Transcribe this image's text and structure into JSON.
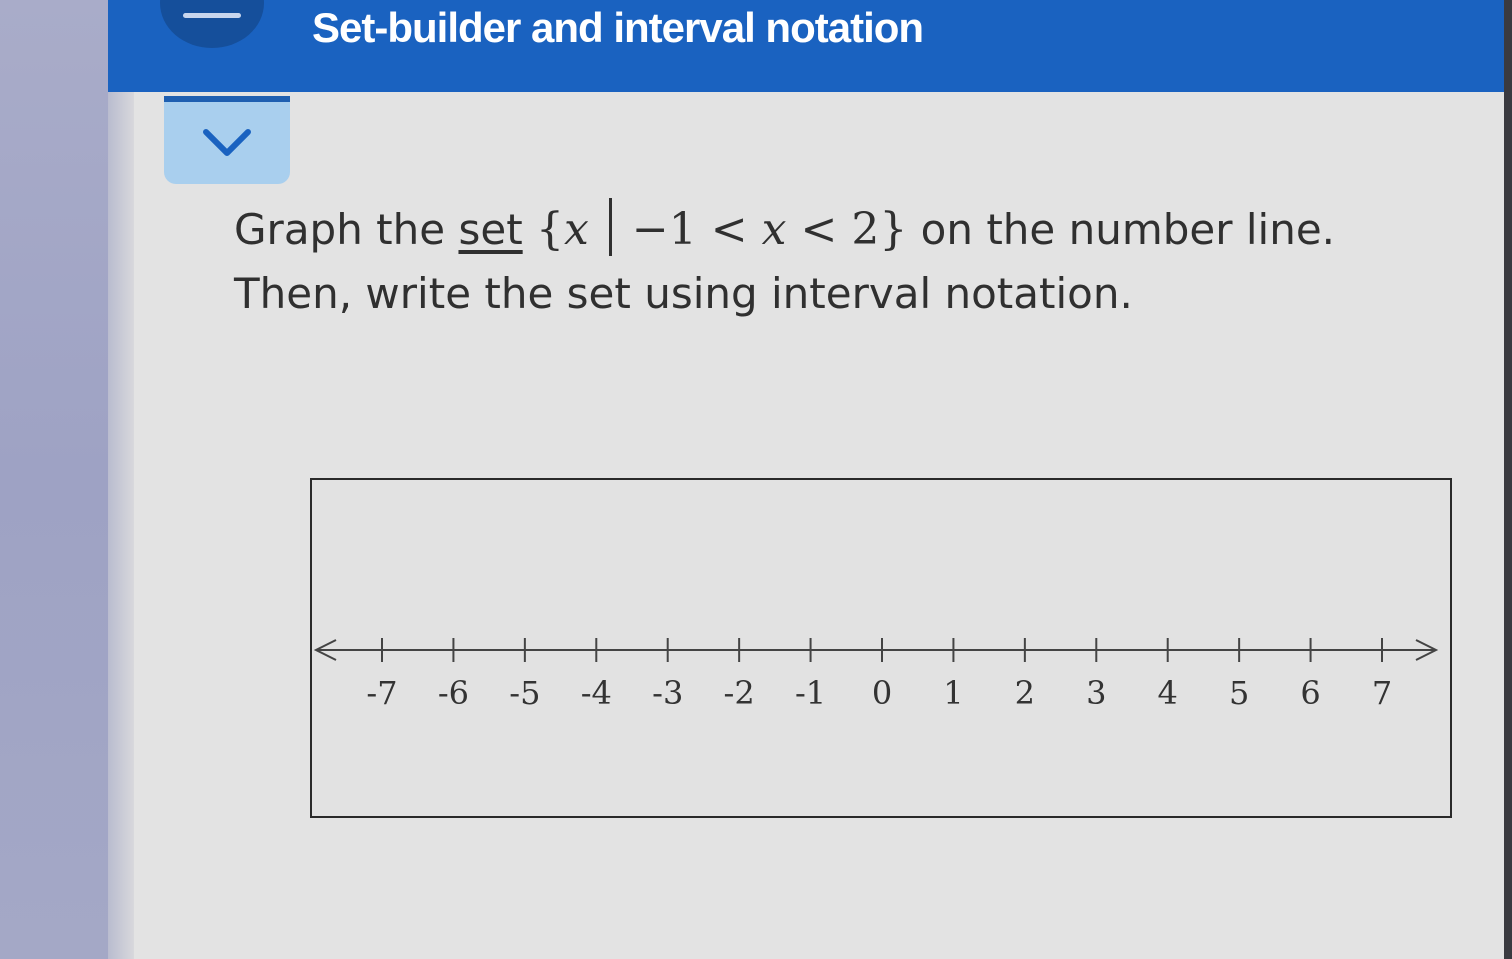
{
  "header": {
    "title": "Set-builder and interval notation"
  },
  "question": {
    "prefix": "Graph the ",
    "set_link": "set",
    "open_brace": "{",
    "var_x": "x",
    "lower": "−1",
    "lt1": "<",
    "var_x2": "x",
    "lt2": "<",
    "upper": "2",
    "close_brace": "}",
    "suffix": " on the number line.",
    "line2": "Then, write the set using interval notation."
  },
  "chart_data": {
    "type": "number-line",
    "ticks": [
      -7,
      -6,
      -5,
      -4,
      -3,
      -2,
      -1,
      0,
      1,
      2,
      3,
      4,
      5,
      6,
      7
    ],
    "tick_labels": [
      "-7",
      "-6",
      "-5",
      "-4",
      "-3",
      "-2",
      "-1",
      "0",
      "1",
      "2",
      "3",
      "4",
      "5",
      "6",
      "7"
    ],
    "xlim": [
      -7,
      7
    ],
    "arrows": "both-ends",
    "colors": {
      "line": "#444444"
    }
  },
  "colors": {
    "header_bg": "#1a62c0",
    "tab_bg": "#a9cfee",
    "chevron": "#1a62c0"
  },
  "icons": {
    "menu": "menu-dash-icon",
    "collapse": "chevron-down-icon"
  }
}
